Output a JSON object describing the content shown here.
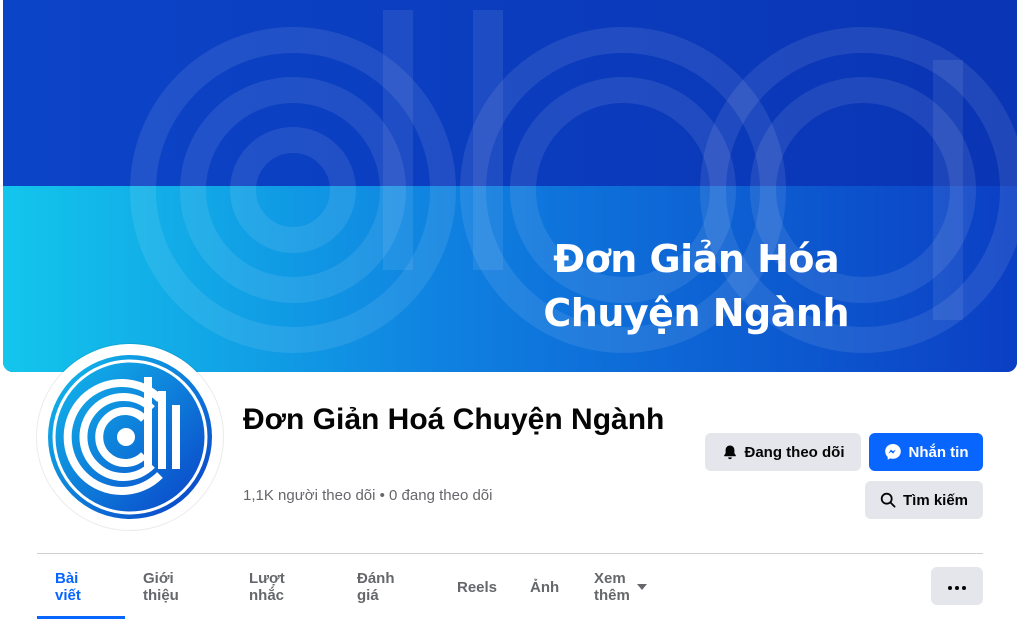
{
  "cover": {
    "title_line1": "Đơn Giản Hóa",
    "title_line2": "Chuyện Ngành",
    "colors": {
      "top": "#0b3fc4",
      "bottom_left": "#12c3ea",
      "bottom_right": "#0b3fc4"
    }
  },
  "page": {
    "name": "Đơn Giản Hoá Chuyện Ngành",
    "followers_text": "1,1K người theo dõi • 0 đang theo dõi"
  },
  "actions": {
    "following_label": "Đang theo dõi",
    "message_label": "Nhắn tin",
    "search_label": "Tìm kiếm"
  },
  "tabs": [
    {
      "label": "Bài viết",
      "active": true
    },
    {
      "label": "Giới thiệu",
      "active": false
    },
    {
      "label": "Lượt nhắc",
      "active": false
    },
    {
      "label": "Đánh giá",
      "active": false
    },
    {
      "label": "Reels",
      "active": false
    },
    {
      "label": "Ảnh",
      "active": false
    },
    {
      "label": "Xem thêm",
      "active": false
    }
  ],
  "icons": {
    "following": "bell-icon",
    "message": "messenger-icon",
    "search": "search-icon",
    "more": "caret-down-icon",
    "options": "more-dots-icon"
  },
  "theme": {
    "accent": "#0866ff",
    "button_gray": "#e4e6eb",
    "muted_text": "#65676b"
  }
}
